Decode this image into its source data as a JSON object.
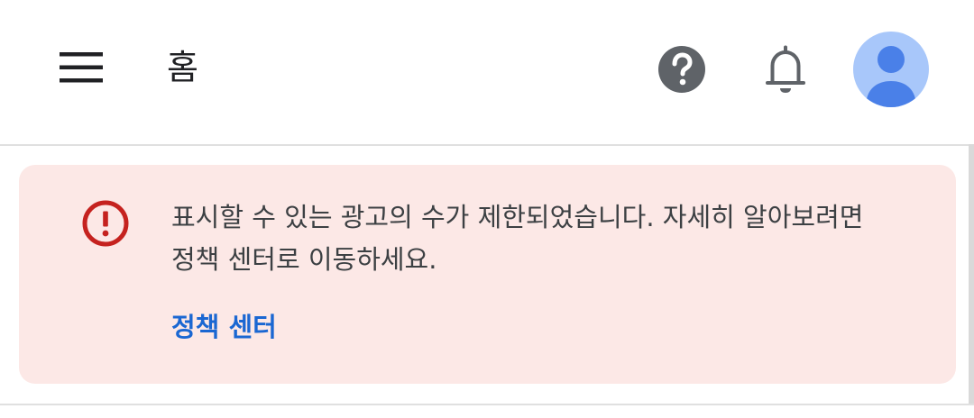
{
  "appbar": {
    "title": "홈",
    "icons": {
      "menu": "hamburger-menu-icon",
      "help": "help-circle-icon",
      "notifications": "bell-icon",
      "account": "account-avatar-icon"
    }
  },
  "banner": {
    "icon": "error-circle-icon",
    "message": "표시할 수 있는 광고의 수가 제한되었습니다. 자세히 알아보려면 정책 센터로 이동하세요.",
    "link_label": "정책 센터"
  },
  "colors": {
    "banner_background": "#fce8e6",
    "error_red": "#c5221f",
    "link_blue": "#1a67d2",
    "avatar_background": "#a8c7fa",
    "avatar_figure": "#4a80e8",
    "icon_gray": "#5f6368"
  }
}
